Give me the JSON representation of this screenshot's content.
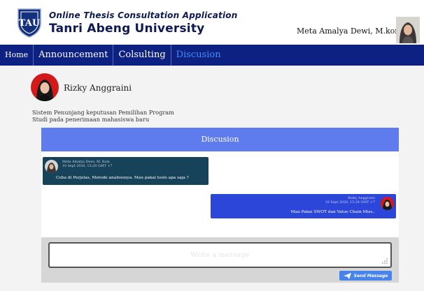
{
  "header": {
    "app_title": "Online Thesis Consultation Application",
    "university": "Tanri Abeng University",
    "user_name": "Meta Amalya Dewi, M.kom",
    "logo_text": "TAU"
  },
  "nav": {
    "items": [
      {
        "label": "Home"
      },
      {
        "label": "Announcement"
      },
      {
        "label": "Colsulting"
      },
      {
        "label": "Discusion"
      }
    ]
  },
  "student": {
    "name": "Rizky Anggraini",
    "thesis_line1": "Sistem Penunjang keputusan Pemilihan Program",
    "thesis_line2": "Studi pada penerimaan mahasiswa baru"
  },
  "discussion": {
    "title": "Discusion",
    "messages": [
      {
        "sender": "Meta Amalya Dewi, M. Kom",
        "time": "10 Sept 2020, 15:20 GMT +7",
        "text": "Coba di Perjelas, Metode analisisnya. Mau pakai tools apa saja ?"
      },
      {
        "sender": "Rizky Anggraini",
        "time": "10 Sept 2020, 15:24 GMT +7",
        "text": "Mau Pakai SWOT dan Value Chain Miss.."
      }
    ],
    "input_placeholder": "Write a message",
    "send_label": "Send Message"
  },
  "colors": {
    "nav_bg": "#0d2182",
    "nav_active": "#3f8ff6",
    "panel_header": "#5f7cee",
    "msg_left": "#16425a",
    "msg_right": "#2c46d9",
    "send_button": "#4883ec"
  }
}
